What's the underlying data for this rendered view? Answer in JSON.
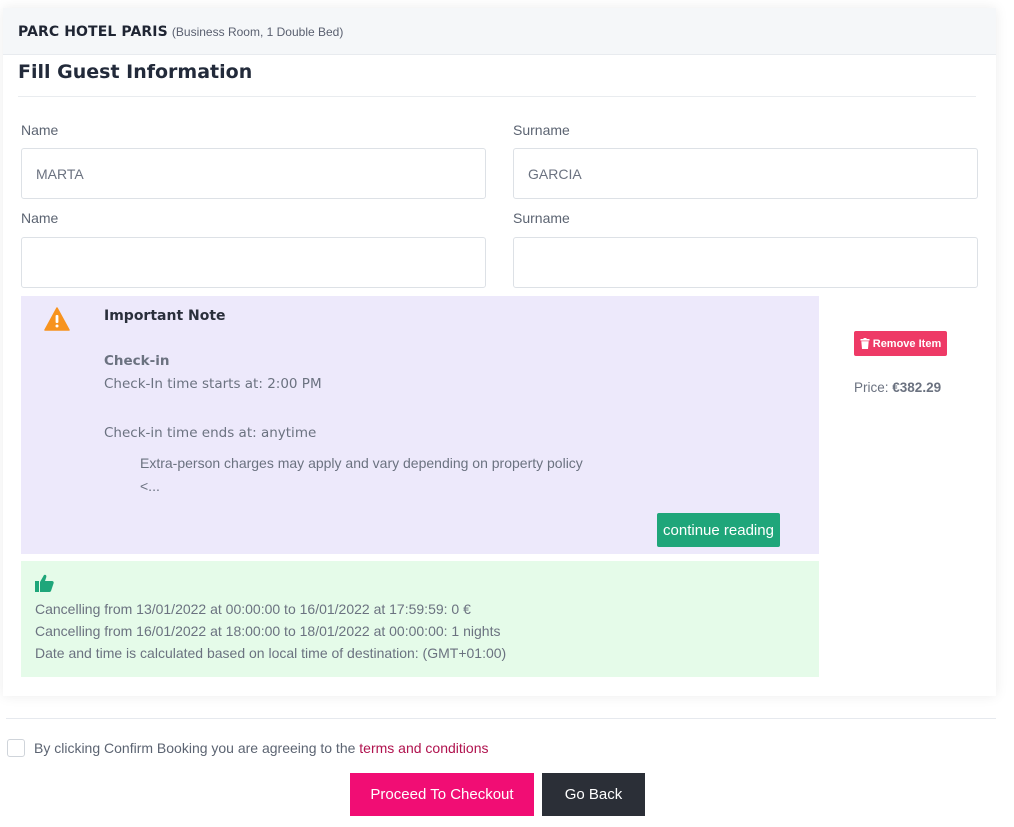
{
  "header": {
    "hotel_name": "PARC HOTEL PARIS",
    "room_desc": "(Business Room, 1 Double Bed)"
  },
  "form": {
    "title": "Fill Guest Information",
    "guests": [
      {
        "name_label": "Name",
        "surname_label": "Surname",
        "name_value": "MARTA",
        "surname_value": "GARCIA"
      },
      {
        "name_label": "Name",
        "surname_label": "Surname",
        "name_value": "",
        "surname_value": ""
      }
    ]
  },
  "note": {
    "icon": "warning-icon",
    "title": "Important Note",
    "checkin_heading": "Check-in",
    "checkin_start": "Check-In time starts at: 2:00 PM",
    "checkin_end": "Check-in time ends at: anytime",
    "extra_person": "Extra-person charges may apply and vary depending on property policy",
    "truncated": "<...",
    "continue_label": "continue reading"
  },
  "item": {
    "remove_label": "Remove Item",
    "price_label": "Price:",
    "price_value": "€382.29"
  },
  "policy": {
    "icon": "thumbs-up-icon",
    "lines": [
      "Cancelling from 13/01/2022 at 00:00:00 to 16/01/2022 at 17:59:59: 0 €",
      "Cancelling from 16/01/2022 at 18:00:00 to 18/01/2022 at 00:00:00: 1 nights",
      "Date and time is calculated based on local time of destination: (GMT+01:00)"
    ]
  },
  "footer": {
    "terms_prefix": "By clicking Confirm Booking you are agreeing to the",
    "terms_link": "terms and conditions",
    "checkout_label": "Proceed To Checkout",
    "back_label": "Go Back"
  },
  "colors": {
    "accent_pink": "#f10d74",
    "remove_red": "#ee3a66",
    "continue_green": "#1fa67a",
    "note_bg": "#ede9fb",
    "policy_bg": "#e5fbe9",
    "warning_orange": "#f7931e"
  }
}
